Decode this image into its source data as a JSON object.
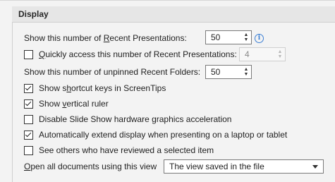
{
  "section": {
    "title": "Display"
  },
  "recent_presentations": {
    "label_pre": "Show this number of ",
    "label_accel": "R",
    "label_post": "ecent Presentations:",
    "value": "50"
  },
  "quick_access": {
    "label_accel": "Q",
    "label_post": "uickly access this number of Recent Presentations:",
    "checked": false,
    "value": "4"
  },
  "recent_folders": {
    "label": "Show this number of unpinned Recent Folders:",
    "value": "50"
  },
  "options": [
    {
      "pre": "Show s",
      "accel": "h",
      "post": "ortcut keys in ScreenTips",
      "checked": true
    },
    {
      "pre": "Show ",
      "accel": "v",
      "post": "ertical ruler",
      "checked": true
    },
    {
      "pre": "",
      "accel": "",
      "post": "Disable Slide Show hardware graphics acceleration",
      "checked": false
    },
    {
      "pre": "",
      "accel": "",
      "post": "Automatically extend display when presenting on a laptop or tablet",
      "checked": true
    },
    {
      "pre": "",
      "accel": "",
      "post": "See others who have reviewed a selected item",
      "checked": false
    }
  ],
  "open_documents": {
    "label_accel": "O",
    "label_post": "pen all documents using this view",
    "selected": "The view saved in the file"
  },
  "icons": {
    "info": "info-icon",
    "spinner": "chevron-up-down-icon",
    "dropdown": "caret-down-icon"
  },
  "colors": {
    "accent": "#3b7fd4",
    "header_bg": "#e6e6e6",
    "page_bg": "#f3f3f3"
  }
}
